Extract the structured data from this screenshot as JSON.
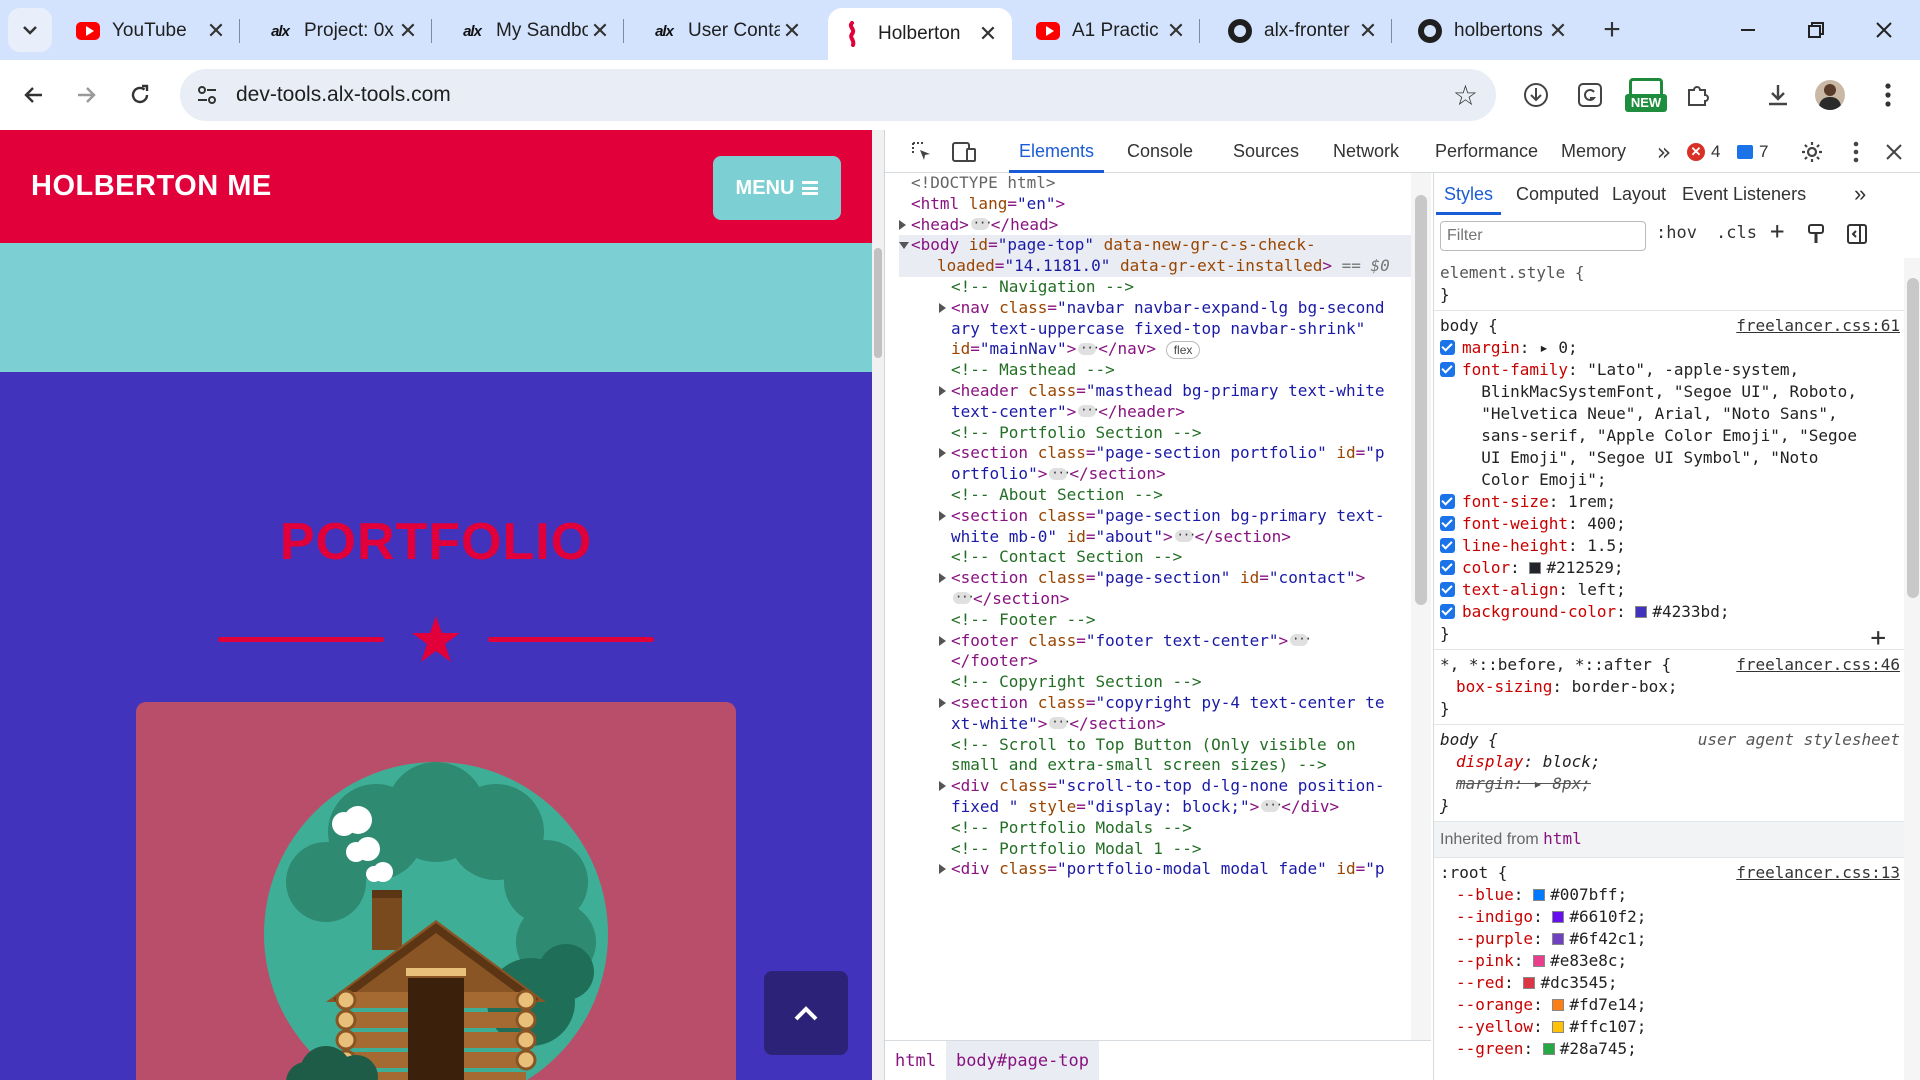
{
  "tabs": [
    {
      "title": "YouTube",
      "icon": "youtube-icon"
    },
    {
      "title": "Project: 0x",
      "icon": "alx-icon"
    },
    {
      "title": "My Sandbo",
      "icon": "alx-icon"
    },
    {
      "title": "User Conta",
      "icon": "alx-icon"
    },
    {
      "title": "Holberton",
      "icon": "holberton-icon",
      "active": true
    },
    {
      "title": "A1 Practic",
      "icon": "youtube-icon"
    },
    {
      "title": "alx-fronter",
      "icon": "github-icon"
    },
    {
      "title": "holbertons",
      "icon": "github-icon"
    }
  ],
  "toolbar": {
    "url": "dev-tools.alx-tools.com",
    "new_badge": "NEW"
  },
  "site": {
    "brand": "HOLBERTON ME",
    "menu_label": "MENU",
    "section_title": "PORTFOLIO",
    "colors": {
      "nav": "#e1003a",
      "masthead": "#7ccfd2",
      "body": "#4233bd",
      "card": "#b94e6a"
    }
  },
  "devtools": {
    "tabs": [
      "Elements",
      "Console",
      "Sources",
      "Network",
      "Performance",
      "Memory"
    ],
    "active_tab": "Elements",
    "error_count": "4",
    "message_count": "7",
    "dom_lines": [
      {
        "indent": 0,
        "doctype": "<!DOCTYPE html>"
      },
      {
        "indent": 0,
        "tag": "<html ",
        "attr": "lang",
        "val": "\"en\"",
        "close": ">"
      },
      {
        "indent": 0,
        "tri": "right",
        "tag": "<head>",
        "ellip": true,
        "tail": "</head>"
      },
      {
        "indent": 0,
        "tri": "down",
        "sel": true,
        "dots": true,
        "tag": "<body ",
        "attr": "id",
        "val": "\"page-top\"",
        "attr2": " data-new-gr-c-s-check-"
      },
      {
        "indent": 1,
        "sel": true,
        "attr": "loaded",
        "val": "\"14.1181.0\"",
        "attr2": " data-gr-ext-installed",
        "close": ">",
        "eq0": " == $0"
      },
      {
        "indent": 2,
        "comment": "<!-- Navigation -->"
      },
      {
        "indent": 2,
        "tri": "right",
        "tag": "<nav ",
        "attr": "class",
        "val": "\"navbar navbar-expand-lg bg-second"
      },
      {
        "indent": 2,
        "val": "ary text-uppercase fixed-top navbar-shrink\""
      },
      {
        "indent": 2,
        "attr": "id",
        "val": "\"mainNav\"",
        "close": ">",
        "ellip": true,
        "tail": "</nav>",
        "chip": "flex"
      },
      {
        "indent": 2,
        "comment": "<!-- Masthead -->"
      },
      {
        "indent": 2,
        "tri": "right",
        "tag": "<header ",
        "attr": "class",
        "val": "\"masthead bg-primary text-white"
      },
      {
        "indent": 2,
        "val": "text-center\"",
        "close": ">",
        "ellip": true,
        "tail": "</header>"
      },
      {
        "indent": 2,
        "comment": "<!-- Portfolio Section -->"
      },
      {
        "indent": 2,
        "tri": "right",
        "tag": "<section ",
        "attr": "class",
        "val": "\"page-section portfolio\"",
        "attr2": " id",
        "val2": "=\"p"
      },
      {
        "indent": 2,
        "val": "ortfolio\"",
        "close": ">",
        "ellip": true,
        "tail": "</section>"
      },
      {
        "indent": 2,
        "comment": "<!-- About Section -->"
      },
      {
        "indent": 2,
        "tri": "right",
        "tag": "<section ",
        "attr": "class",
        "val": "\"page-section bg-primary text-"
      },
      {
        "indent": 2,
        "val": "white mb-0\"",
        "attr2": " id",
        "val2": "=\"about\"",
        "close": ">",
        "ellip": true,
        "tail": "</section>"
      },
      {
        "indent": 2,
        "comment": "<!-- Contact Section -->"
      },
      {
        "indent": 2,
        "tri": "right",
        "tag": "<section ",
        "attr": "class",
        "val": "\"page-section\"",
        "attr2": " id",
        "val2": "=\"contact\"",
        "close": ">"
      },
      {
        "indent": 2,
        "ellip": true,
        "tail": "</section>"
      },
      {
        "indent": 2,
        "comment": "<!-- Footer -->"
      },
      {
        "indent": 2,
        "tri": "right",
        "tag": "<footer ",
        "attr": "class",
        "val": "\"footer text-center\"",
        "close": ">",
        "ellip": true
      },
      {
        "indent": 2,
        "tail": "</footer>"
      },
      {
        "indent": 2,
        "comment": "<!-- Copyright Section -->"
      },
      {
        "indent": 2,
        "tri": "right",
        "tag": "<section ",
        "attr": "class",
        "val": "\"copyright py-4 text-center te"
      },
      {
        "indent": 2,
        "val": "xt-white\"",
        "close": ">",
        "ellip": true,
        "tail": "</section>"
      },
      {
        "indent": 2,
        "comment": "<!-- Scroll to Top Button (Only visible on"
      },
      {
        "indent": 2,
        "comment": "small and extra-small screen sizes) -->"
      },
      {
        "indent": 2,
        "tri": "right",
        "tag": "<div ",
        "attr": "class",
        "val": "\"scroll-to-top d-lg-none position-"
      },
      {
        "indent": 2,
        "val": "fixed \"",
        "attr2": " style",
        "val2": "=\"display: block;\"",
        "close": ">",
        "ellip": true,
        "tail": "</div>"
      },
      {
        "indent": 2,
        "comment": "<!-- Portfolio Modals -->"
      },
      {
        "indent": 2,
        "comment": "<!-- Portfolio Modal 1 -->"
      },
      {
        "indent": 2,
        "tri": "right",
        "tag": "<div ",
        "attr": "class",
        "val": "\"portfolio-modal modal fade\"",
        "attr2": " id",
        "val2": "=\"p"
      }
    ],
    "breadcrumbs": [
      "html",
      "body#page-top"
    ],
    "styles_tabs": [
      "Styles",
      "Computed",
      "Layout",
      "Event Listeners"
    ],
    "filter_placeholder": "Filter",
    "hov": ":hov",
    "cls": ".cls",
    "element_style": "element.style {",
    "close_brace": "}",
    "body_rule": {
      "selector": "body {",
      "source": "freelancer.css:61",
      "props": [
        {
          "name": "margin",
          "value": "▸ 0;"
        },
        {
          "name": "font-family",
          "value": "\"Lato\", -apple-system,\n  BlinkMacSystemFont, \"Segoe UI\", Roboto,\n  \"Helvetica Neue\", Arial, \"Noto Sans\",\n  sans-serif, \"Apple Color Emoji\", \"Segoe\n  UI Emoji\", \"Segoe UI Symbol\", \"Noto\n  Color Emoji\";"
        },
        {
          "name": "font-size",
          "value": "1rem;"
        },
        {
          "name": "font-weight",
          "value": "400;"
        },
        {
          "name": "line-height",
          "value": "1.5;"
        },
        {
          "name": "color",
          "value": "#212529;",
          "swatch": "#212529"
        },
        {
          "name": "text-align",
          "value": "left;"
        },
        {
          "name": "background-color",
          "value": "#4233bd;",
          "swatch": "#4233bd"
        }
      ]
    },
    "universal_rule": {
      "selector": "*, *::before, *::after {",
      "source": "freelancer.css:46",
      "prop": {
        "name": "box-sizing",
        "value": "border-box;"
      }
    },
    "ua_rule": {
      "selector": "body {",
      "source": "user agent stylesheet",
      "display": {
        "name": "display",
        "value": "block;"
      },
      "margin": {
        "name": "margin",
        "value": "▸ 8px;"
      }
    },
    "inherited_label": "Inherited from",
    "inherited_from": "html",
    "root_rule": {
      "selector": ":root {",
      "source": "freelancer.css:13",
      "vars": [
        {
          "name": "--blue",
          "value": "#007bff;",
          "swatch": "#007bff"
        },
        {
          "name": "--indigo",
          "value": "#6610f2;",
          "swatch": "#6610f2"
        },
        {
          "name": "--purple",
          "value": "#6f42c1;",
          "swatch": "#6f42c1"
        },
        {
          "name": "--pink",
          "value": "#e83e8c;",
          "swatch": "#e83e8c"
        },
        {
          "name": "--red",
          "value": "#dc3545;",
          "swatch": "#dc3545"
        },
        {
          "name": "--orange",
          "value": "#fd7e14;",
          "swatch": "#fd7e14"
        },
        {
          "name": "--yellow",
          "value": "#ffc107;",
          "swatch": "#ffc107"
        },
        {
          "name": "--green",
          "value": "#28a745;",
          "swatch": "#28a745"
        }
      ]
    }
  }
}
